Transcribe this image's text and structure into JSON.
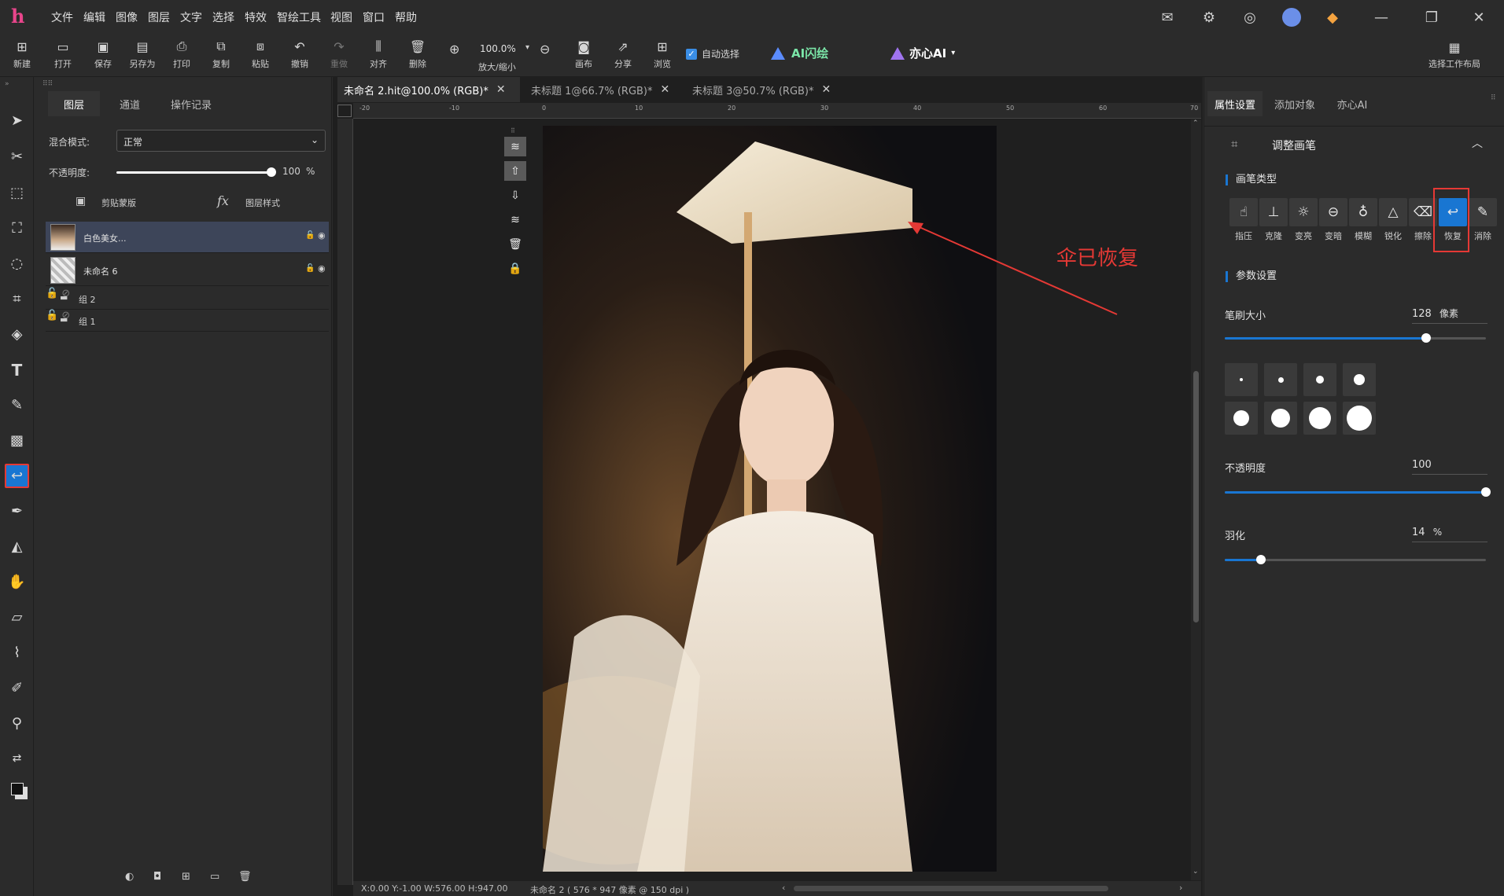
{
  "menu": {
    "items": [
      "文件",
      "编辑",
      "图像",
      "图层",
      "文字",
      "选择",
      "特效",
      "智绘工具",
      "视图",
      "窗口",
      "帮助"
    ]
  },
  "toolbar": {
    "buttons": [
      {
        "label": "新建",
        "icon": "new-file-icon"
      },
      {
        "label": "打开",
        "icon": "open-folder-icon"
      },
      {
        "label": "保存",
        "icon": "save-icon"
      },
      {
        "label": "另存为",
        "icon": "save-as-icon"
      },
      {
        "label": "打印",
        "icon": "print-icon"
      },
      {
        "label": "复制",
        "icon": "copy-icon"
      },
      {
        "label": "粘贴",
        "icon": "paste-icon"
      },
      {
        "label": "撤销",
        "icon": "undo-icon"
      },
      {
        "label": "重做",
        "icon": "redo-icon"
      },
      {
        "label": "对齐",
        "icon": "align-icon"
      },
      {
        "label": "删除",
        "icon": "trash-icon"
      }
    ],
    "zoom_value": "100.0%",
    "zoom_label": "放大/缩小",
    "canvas_label": "画布",
    "share_label": "分享",
    "browse_label": "浏览",
    "auto_select_label": "自动选择",
    "ai_flash_label": "AI闪绘",
    "yixin_label": "亦心AI",
    "workspace_label": "选择工作布局"
  },
  "layers_panel": {
    "tabs": [
      "图层",
      "通道",
      "操作记录"
    ],
    "blend_mode_label": "混合模式:",
    "blend_mode_value": "正常",
    "opacity_label": "不透明度:",
    "opacity_value": "100",
    "opacity_unit": "%",
    "opacity_fraction": 1.0,
    "clip_mask_label": "剪贴蒙版",
    "layer_style_label": "图层样式",
    "layers": [
      {
        "name": "白色美女...",
        "selected": true
      },
      {
        "name": "未命名 6",
        "selected": false
      }
    ],
    "groups": [
      {
        "name": "组 2"
      },
      {
        "name": "组 1"
      }
    ]
  },
  "document": {
    "tabs": [
      {
        "label": "未命名 2.hit@100.0% (RGB)*",
        "active": true
      },
      {
        "label": "未标题 1@66.7% (RGB)*",
        "active": false
      },
      {
        "label": "未标题 3@50.7% (RGB)*",
        "active": false
      }
    ],
    "ruler_numbers": [
      "-20",
      "-10",
      "0",
      "10",
      "20",
      "30",
      "40",
      "50",
      "60",
      "70"
    ],
    "annotation_text": "伞已恢复",
    "status_left": "X:0.00 Y:-1.00 W:576.00 H:947.00 ",
    "status_doc": "未命名 2 ( 576 * 947 像素 @ 150 dpi )"
  },
  "right_panel": {
    "tabs": [
      "属性设置",
      "添加对象",
      "亦心AI"
    ],
    "section_title": "调整画笔",
    "brush_type_title": "画笔类型",
    "brush_types": [
      {
        "label": "指压",
        "icon": "smudge-icon"
      },
      {
        "label": "克隆",
        "icon": "clone-stamp-icon"
      },
      {
        "label": "变亮",
        "icon": "brighten-icon"
      },
      {
        "label": "变暗",
        "icon": "darken-icon"
      },
      {
        "label": "模糊",
        "icon": "blur-drop-icon"
      },
      {
        "label": "锐化",
        "icon": "sharpen-triangle-icon"
      },
      {
        "label": "擦除",
        "icon": "eraser-icon"
      },
      {
        "label": "恢复",
        "icon": "restore-icon",
        "active": true
      },
      {
        "label": "消除",
        "icon": "remove-brush-icon"
      }
    ],
    "params_title": "参数设置",
    "brush_size_label": "笔刷大小",
    "brush_size_value": "128",
    "brush_size_unit": "像素",
    "brush_size_fraction": 0.77,
    "opacity_label": "不透明度",
    "opacity_value": "100",
    "opacity_fraction": 1.0,
    "feather_label": "羽化",
    "feather_value": "14",
    "feather_unit": "%",
    "feather_fraction": 0.14
  },
  "colors": {
    "accent": "#1976d2",
    "highlight_red": "#e53935",
    "selected_layer": "#3d4559",
    "logo": "#e8458b"
  }
}
